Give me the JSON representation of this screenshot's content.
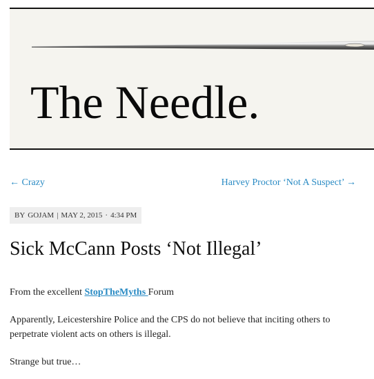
{
  "site": {
    "title": "The Needle."
  },
  "post_nav": {
    "prev_arrow": "←",
    "prev_label": "Crazy",
    "next_label": "Harvey Proctor ‘Not A Suspect’",
    "next_arrow": "→"
  },
  "meta": {
    "by": "BY",
    "author": "GOJAM",
    "separator": "|",
    "date": "MAY 2, 2015",
    "dot": "·",
    "time": "4:34 PM"
  },
  "post": {
    "title": "Sick McCann Posts ‘Not Illegal’",
    "p1_before": "From the excellent ",
    "p1_link": "StopTheMyths ",
    "p1_after": "Forum",
    "p2": "Apparently, Leicestershire Police and the CPS do not believe that inciting others to perpetrate violent acts on others is illegal.",
    "p3": "Strange but true…"
  },
  "colors": {
    "link": "#2a8bc4",
    "meta_bg": "#eeeeee",
    "header_bg": "#f5f4ef"
  },
  "icons": {
    "header_image": "needle-image"
  }
}
